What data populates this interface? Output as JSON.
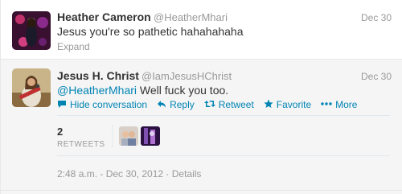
{
  "tweet1": {
    "name": "Heather Cameron",
    "handle": "@HeatherMhari",
    "time": "Dec 30",
    "text": "Jesus you're so pathetic hahahahaha",
    "expand": "Expand"
  },
  "tweet2": {
    "name": "Jesus H. Christ",
    "handle": "@IamJesusHChrist",
    "time": "Dec 30",
    "mention": "@HeatherMhari",
    "text": " Well fuck you too.",
    "actions": {
      "hide": "Hide conversation",
      "reply": "Reply",
      "retweet": "Retweet",
      "favorite": "Favorite",
      "more": "More"
    },
    "retweet_count": "2",
    "retweet_label": "RETWEETS",
    "timestamp": "2:48 a.m. - Dec 30, 2012",
    "details": "Details"
  },
  "colors": {
    "link": "#0084b4",
    "muted": "#999999",
    "text": "#333333",
    "expanded_bg": "#f5f5f5"
  }
}
